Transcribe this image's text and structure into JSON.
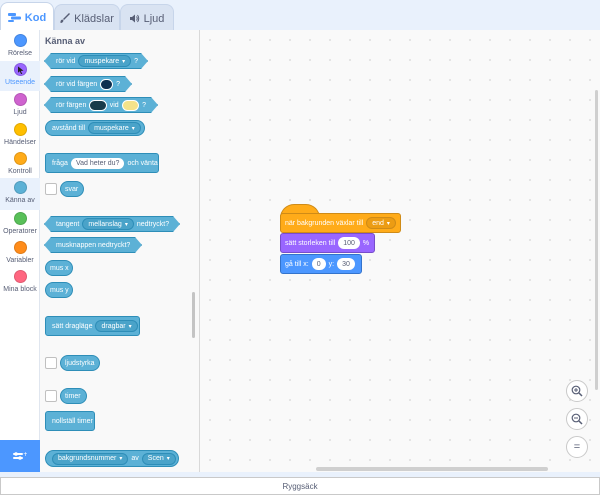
{
  "tabs": [
    {
      "label": "Kod",
      "icon": "code-icon",
      "active": true
    },
    {
      "label": "Klädslar",
      "icon": "brush-icon"
    },
    {
      "label": "Ljud",
      "icon": "speaker-icon"
    }
  ],
  "categories": [
    {
      "label": "Rörelse",
      "color": "#4c97ff"
    },
    {
      "label": "Utseende",
      "color": "#9966ff"
    },
    {
      "label": "Ljud",
      "color": "#cf63cf"
    },
    {
      "label": "Händelser",
      "color": "#ffbf00"
    },
    {
      "label": "Kontroll",
      "color": "#ffab19"
    },
    {
      "label": "Känna av",
      "color": "#5cb1d6",
      "selected": true
    },
    {
      "label": "Operatorer",
      "color": "#59c059"
    },
    {
      "label": "Variabler",
      "color": "#ff8c1a"
    },
    {
      "label": "Mina block",
      "color": "#ff6680"
    }
  ],
  "palette": {
    "heading": "Känna av",
    "touching": {
      "text": "rör vid",
      "menu": "muspekare",
      "q": "?"
    },
    "touching_color": {
      "text": "rör vid färgen",
      "q": "?",
      "color": "#0d2f4f"
    },
    "color_touching": {
      "text1": "rör färgen",
      "text2": "vid",
      "q": "?",
      "color1": "#183c4a",
      "color2": "#f4e28a"
    },
    "distance": {
      "text": "avstånd till",
      "menu": "muspekare"
    },
    "ask": {
      "text": "fråga",
      "value": "Vad heter du?",
      "text2": "och vänta"
    },
    "answer": "svar",
    "key_pressed": {
      "text": "tangent",
      "menu": "mellanslag",
      "text2": "nedtryckt?"
    },
    "mouse_down": "musknappen nedtryckt?",
    "mouse_x": "mus x",
    "mouse_y": "mus y",
    "drag_mode": {
      "text": "sätt dragläge",
      "menu": "dragbar"
    },
    "loudness": "ljudstyrka",
    "timer": "timer",
    "reset_timer": "nollställ timer",
    "of": {
      "menu1": "bakgrundsnummer",
      "text": "av",
      "menu2": "Scen"
    }
  },
  "script": {
    "hat": {
      "text": "när bakgrunden växlar till",
      "menu": "end"
    },
    "size": {
      "text": "sätt storleken till",
      "value": "100",
      "unit": "%"
    },
    "goto": {
      "text": "gå till x:",
      "x": "0",
      "ylabel": "y:",
      "y": "30"
    }
  },
  "zoom": {
    "in": "+",
    "out": "−",
    "reset": "="
  },
  "backpack": "Ryggsäck"
}
